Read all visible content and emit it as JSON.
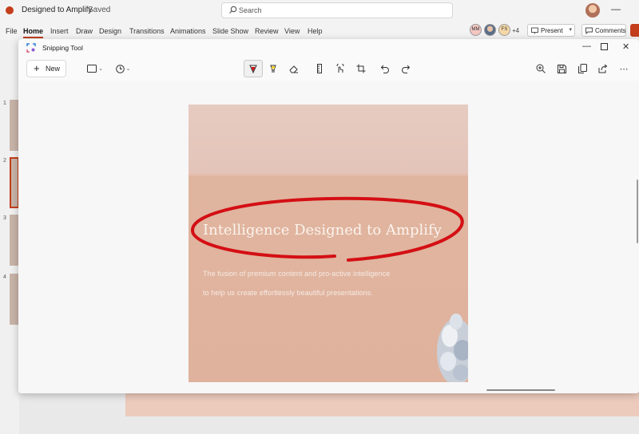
{
  "app": {
    "title": "Designed to Amplify",
    "save_status": "Saved",
    "search_placeholder": "Search"
  },
  "ribbon": {
    "tabs": [
      "File",
      "Home",
      "Insert",
      "Draw",
      "Design",
      "Transitions",
      "Animations",
      "Slide Show",
      "Review",
      "View",
      "Help"
    ],
    "active_tab": "Home",
    "coauthors": [
      "MM",
      "FS"
    ],
    "coauthor_more": "+4",
    "present_label": "Present",
    "comments_label": "Comments"
  },
  "slides_panel": {
    "numbers": [
      "1",
      "2",
      "3",
      "4"
    ],
    "selected": "2"
  },
  "snipping_tool": {
    "title": "Snipping Tool",
    "new_label": "New",
    "tools": [
      "snip-mode",
      "delay",
      "ballpoint-pen",
      "highlighter",
      "eraser",
      "ruler",
      "touch-writing",
      "crop",
      "undo",
      "redo",
      "zoom",
      "save",
      "copy",
      "share"
    ],
    "active_tool": "ballpoint-pen",
    "pen_color": "#d40f14"
  },
  "capture": {
    "heading": "Intelligence Designed to Amplify",
    "body_line1": "The fusion of premium content and pro-active intelligence",
    "body_line2": "to help us create effortlessly beautiful presentations."
  },
  "colors": {
    "accent": "#c43e1c",
    "annotation": "#d40f14"
  }
}
